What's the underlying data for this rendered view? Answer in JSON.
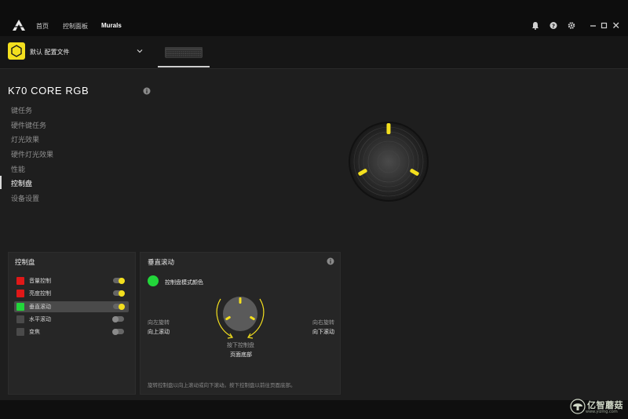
{
  "topbar": {
    "nav": [
      "首页",
      "控制面板",
      "Murals"
    ],
    "active_nav": "Murals",
    "icons": [
      "bell-icon",
      "help-icon",
      "gear-icon",
      "minimize-icon",
      "maximize-icon",
      "close-icon"
    ]
  },
  "profile": {
    "name": "默认 配置文件",
    "icon": "hexagon-profile-icon",
    "accent": "#f3df1e"
  },
  "device": {
    "title": "K70 CORE RGB"
  },
  "sidebar": {
    "items": [
      {
        "label": "键任务",
        "active": false
      },
      {
        "label": "硬件键任务",
        "active": false
      },
      {
        "label": "灯光效果",
        "active": false
      },
      {
        "label": "硬件灯光效果",
        "active": false
      },
      {
        "label": "性能",
        "active": false
      },
      {
        "label": "控制盘",
        "active": true
      },
      {
        "label": "设备设置",
        "active": false
      }
    ]
  },
  "control_panel": {
    "title": "控制盘",
    "zones": [
      {
        "label": "音量控制",
        "color": "#e01818",
        "enabled": true,
        "selected": false
      },
      {
        "label": "亮度控制",
        "color": "#e01818",
        "enabled": true,
        "selected": false
      },
      {
        "label": "垂直滚动",
        "color": "#22d63a",
        "enabled": true,
        "selected": true
      },
      {
        "label": "水平滚动",
        "color": "#4a4a4a",
        "enabled": false,
        "selected": false
      },
      {
        "label": "变焦",
        "color": "#4a4a4a",
        "enabled": false,
        "selected": false
      }
    ]
  },
  "detail_panel": {
    "title": "垂直滚动",
    "color_label": "控制盘模式颜色",
    "mode_color": "#22d63a",
    "left_caption": "向左旋转",
    "left_action": "向上滚动",
    "right_caption": "向右旋转",
    "right_action": "向下滚动",
    "press_caption": "按下控制盘",
    "press_action": "页面底部",
    "footer_note": "旋转控制盘以向上滚动或向下滚动。按下控制盘以前往页面底部。"
  },
  "watermark": {
    "text": "亿智蘑菇",
    "sub": "www.yizmg.com"
  }
}
